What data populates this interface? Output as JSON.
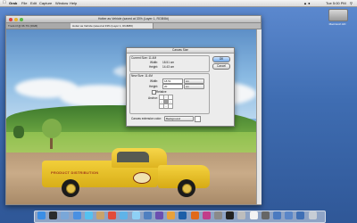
{
  "menubar": {
    "app_name": "Grab",
    "items": [
      "File",
      "Edit",
      "Capture",
      "Window",
      "Help"
    ],
    "clock": "Tue 5:00 PM"
  },
  "desktop": {
    "drive_label": "Macintosh HD"
  },
  "document": {
    "window_title": "Hotter as Vehicle (saved at 33% (Layer 1, RGB/8#)",
    "tabs": [
      "Truck.tif @ 66.7% (RGB)",
      "Hotter as Vehicle (saved at 33% (Layer 1, RGB/8#)"
    ],
    "truck_text": "PRODUCT DISTRIBUTION"
  },
  "dialog": {
    "title": "Canvas Size",
    "current_size": {
      "label": "Current Size: 11.4M",
      "width_label": "Width:",
      "width_value": "18.51 cm",
      "height_label": "Height:",
      "height_value": "14.43 cm"
    },
    "new_size": {
      "label": "New Size: 11.4M",
      "width_label": "Width:",
      "width_value": "18.51",
      "width_unit": "cm",
      "height_label": "Height:",
      "height_value": "20",
      "height_unit": "cm",
      "relative_label": "Relative",
      "anchor_label": "Anchor:"
    },
    "extension_color_label": "Canvas extension color:",
    "extension_color_value": "Background",
    "ok_label": "OK",
    "cancel_label": "Cancel"
  },
  "colors": {
    "ok_button": "#6fa8ea",
    "truck": "#f2cf3a",
    "desktop": "#3d6fb3"
  },
  "dock_icons": [
    "finder-icon",
    "dashboard-icon",
    "mail-icon",
    "safari-icon",
    "ichat-icon",
    "address-book-icon",
    "ical-icon",
    "preview-icon",
    "itunes-icon",
    "iphoto-icon",
    "imovie-icon",
    "garageband-icon",
    "photoshop-icon",
    "illustrator-icon",
    "indesign-icon",
    "system-preferences-icon",
    "terminal-icon",
    "grab-icon",
    "textedit-icon",
    "calculator-icon",
    "applications-folder-icon",
    "documents-folder-icon",
    "downloads-folder-icon",
    "trash-icon"
  ]
}
